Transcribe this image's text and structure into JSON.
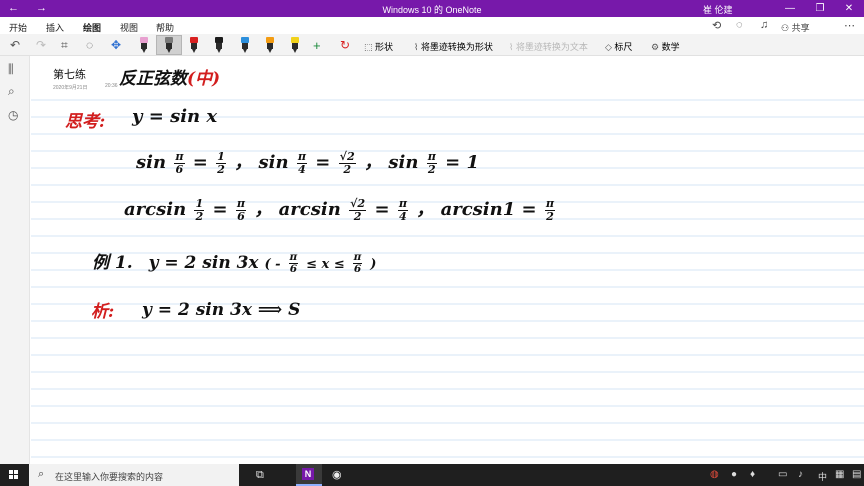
{
  "window": {
    "title": "Windows 10 的 OneNote",
    "user": "崔 伦建",
    "back_icon": "←",
    "forward_icon": "→",
    "minimize": "—",
    "maximize": "❐",
    "close": "✕"
  },
  "tabs": [
    {
      "label": "开始"
    },
    {
      "label": "插入"
    },
    {
      "label": "绘图",
      "active": true
    },
    {
      "label": "视图"
    },
    {
      "label": "帮助"
    }
  ],
  "ribbon_right": {
    "share_label": "共享",
    "sync_icon": "⟲",
    "lightbulb_icon": "◌",
    "bell_icon": "♫",
    "more_icon": "⋯"
  },
  "toolbar": {
    "undo": "↶",
    "redo": "↷",
    "lasso": "⌗",
    "eraser": "◌",
    "insert_space": "✥",
    "add_pen": "+",
    "ink_to_shape_label": "形状",
    "ink_to_text_label": "将墨迹转换为形状",
    "ink_to_text_disabled_label": "将墨迹转换为文本",
    "ruler_label": "标尺",
    "math_label": "数学",
    "pens": [
      {
        "color": "#e8a0d0"
      },
      {
        "color": "#7a7a7a",
        "selected": true
      },
      {
        "color": "#d92121"
      },
      {
        "color": "#1d1d1d"
      },
      {
        "color": "#2c8fdc"
      },
      {
        "color": "#f39c12"
      },
      {
        "color": "#f1d21b"
      },
      {
        "color": "#1b8a3b"
      }
    ]
  },
  "rail": {
    "notebooks_icon": "⫼",
    "search_icon": "⌕",
    "recent_icon": "◷"
  },
  "page": {
    "title": "第七练",
    "date": "2020年9月21日",
    "time": "20:36"
  },
  "ink_lines": {
    "heading": "反正弦数",
    "heading_red": "(中)",
    "think_label": "思考:",
    "think_eq": "y = sin x",
    "line2_a": "sin",
    "frac_pi": "π",
    "frac_6": "6",
    "frac_1": "1",
    "frac_2": "2",
    "frac_4": "4",
    "frac_sqrt2": "√2",
    "line3_arc": "arcsin",
    "line3_arc1": "arcsin1 =",
    "eq": "=",
    "comma": "，",
    "eq_one": "= 1",
    "example_label": "例 1.",
    "example_eq": "y = 2 sin 3x",
    "example_range_l": "( -",
    "example_le": "≤ x ≤",
    "example_range_r": ")",
    "analysis_label": "析:",
    "analysis_eq": "y = 2 sin 3x  ⟹  S"
  },
  "taskbar": {
    "search_placeholder": "在这里输入你要搜索的内容",
    "task_view_icon": "⧉",
    "onenote_letter": "N",
    "other_app_icon": "◉",
    "tray_icons": [
      "◍",
      "●",
      "♦",
      "▭",
      "♪"
    ],
    "ime_label": "中",
    "grid_icon": "▦",
    "notification_icon": "▤"
  }
}
